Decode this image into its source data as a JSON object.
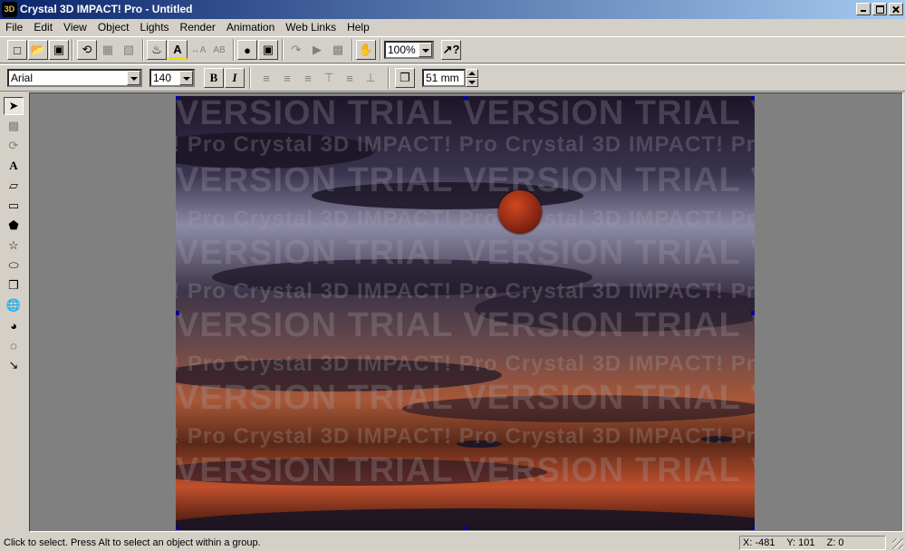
{
  "window": {
    "icon_text": "3D",
    "title": "Crystal 3D IMPACT! Pro - Untitled"
  },
  "menu": [
    "File",
    "Edit",
    "View",
    "Object",
    "Lights",
    "Render",
    "Animation",
    "Web Links",
    "Help"
  ],
  "toolbar": {
    "zoom": "100%"
  },
  "format": {
    "font": "Arial",
    "size": "140",
    "bold": "B",
    "italic": "I",
    "depth": "51 mm"
  },
  "canvas": {
    "watermark_trial": "VERSION TRIAL VERSION TRIAL VERSION TRIAL VERSION",
    "watermark_brand": "IMPACT! Pro  Crystal 3D  IMPACT! Pro  Crystal 3D  IMPACT! Pro"
  },
  "status": {
    "message": "Click to select.  Press Alt to select an object within a group.",
    "x": "X: -481",
    "y": "Y: 101",
    "z": "Z: 0"
  },
  "colors": {
    "title_start": "#0a246a",
    "title_end": "#a6caf0",
    "chrome": "#d4d0c8",
    "workspace": "#808080"
  }
}
